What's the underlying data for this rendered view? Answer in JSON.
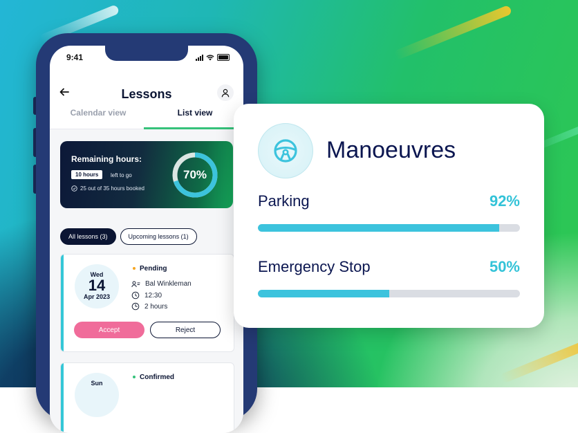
{
  "colors": {
    "accent_teal": "#3cc3dd",
    "accent_green": "#35c27a",
    "accent_pink": "#f06c9a",
    "navy": "#0b1533"
  },
  "status_bar": {
    "time": "9:41"
  },
  "header": {
    "title": "Lessons",
    "back_icon": "arrow-left-icon",
    "profile_icon": "user-icon"
  },
  "tabs": [
    {
      "label": "Calendar view",
      "active": false
    },
    {
      "label": "List view",
      "active": true
    }
  ],
  "hours_card": {
    "title": "Remaining hours:",
    "hours_chip": "10 hours",
    "left_text": "left to go",
    "booked_text": "25 out of 35 hours booked",
    "progress_label": "70%",
    "progress_fraction": 0.7
  },
  "filters": [
    {
      "label": "All lessons (3)",
      "active": true
    },
    {
      "label": "Upcoming lessons (1)",
      "active": false
    }
  ],
  "lessons": [
    {
      "dow": "Wed",
      "day": "14",
      "month": "Apr 2023",
      "status": "Pending",
      "status_color": "#f5a623",
      "instructor": "Bal Winkleman",
      "time": "12:30",
      "duration": "2 hours",
      "accept_label": "Accept",
      "reject_label": "Reject"
    },
    {
      "dow": "Sun",
      "status": "Confirmed",
      "status_color": "#35c27a"
    }
  ],
  "manoeuvres": {
    "title": "Manoeuvres",
    "icon": "steering-wheel-icon",
    "skills": [
      {
        "label": "Parking",
        "percent_label": "92%",
        "value": 0.92
      },
      {
        "label": "Emergency Stop",
        "percent_label": "50%",
        "value": 0.5
      }
    ]
  }
}
